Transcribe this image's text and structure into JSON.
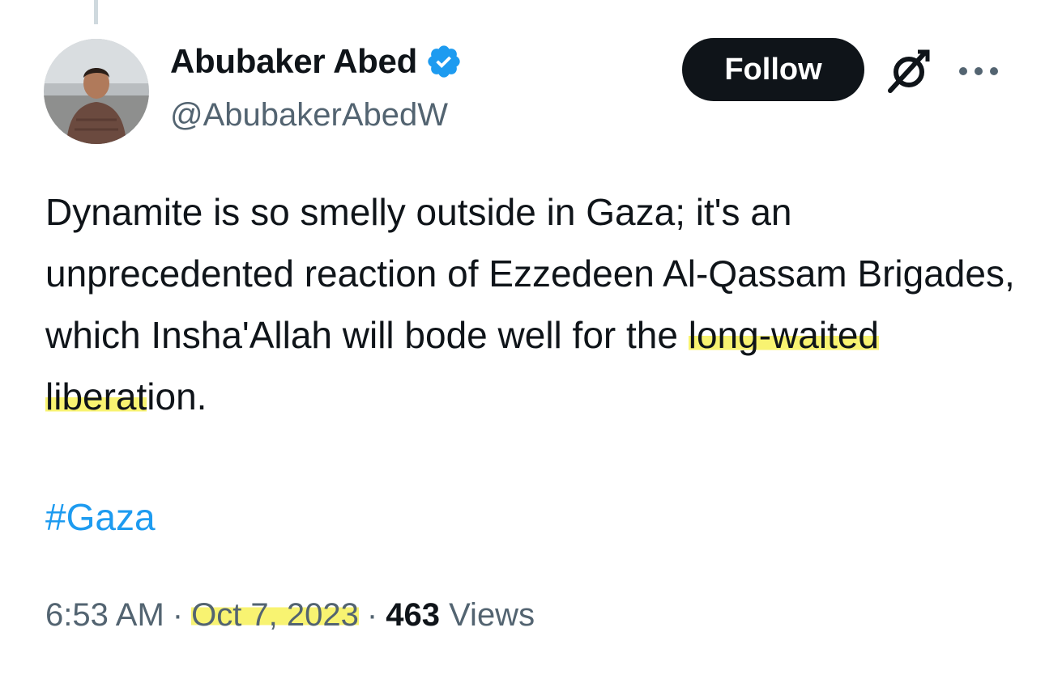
{
  "tweet": {
    "display_name": "Abubaker Abed",
    "handle": "@AbubakerAbedW",
    "follow_label": "Follow",
    "text_before": "Dynamite is so smelly outside in Gaza; it's an unprecedented reaction of Ezzedeen Al-Qassam Brigades, which Insha'Allah will bode well for the ",
    "text_highlight": "long-waited liberat",
    "text_after": "ion.",
    "hashtag": "#Gaza",
    "time": "6:53 AM",
    "separator": "·",
    "date": "Oct 7, 2023",
    "views_count": "463",
    "views_label": "Views"
  },
  "icons": {
    "verified": "verified-badge-icon",
    "grok": "grok-icon",
    "more": "more-options-icon"
  },
  "colors": {
    "verified_badge": "#1d9bf0",
    "hashtag": "#1d9bf0",
    "follow_button_bg": "#0f1419",
    "secondary_text": "#536471",
    "highlight": "#f8f371"
  }
}
